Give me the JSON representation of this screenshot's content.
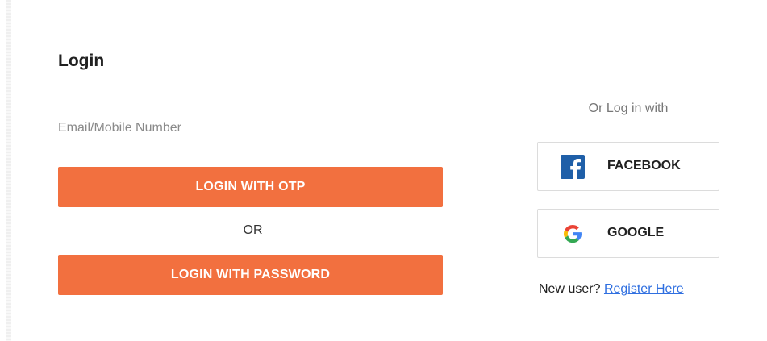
{
  "login": {
    "title": "Login",
    "email_placeholder": "Email/Mobile Number",
    "otp_button": "LOGIN WITH OTP",
    "or_text": "OR",
    "password_button": "LOGIN WITH PASSWORD"
  },
  "social": {
    "title": "Or Log in with",
    "facebook_label": "FACEBOOK",
    "facebook_icon": "facebook-icon",
    "google_label": "GOOGLE",
    "google_icon": "google-icon"
  },
  "register": {
    "prompt": "New user?",
    "link_label": "Register Here"
  },
  "colors": {
    "primary_button": "#f2703f",
    "facebook": "#1f5fa8",
    "link": "#2f6fe0"
  }
}
